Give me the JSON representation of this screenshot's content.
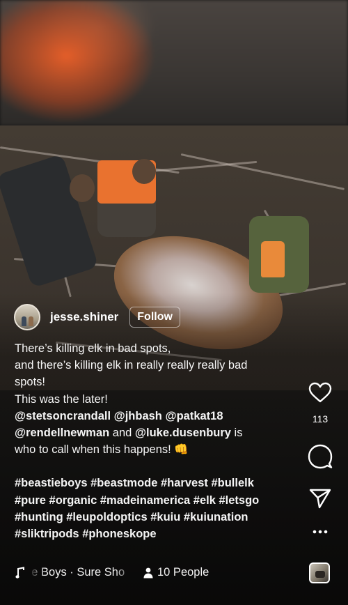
{
  "post": {
    "username": "jesse.shiner",
    "follow_label": "Follow",
    "caption": {
      "line1": "There’s killing elk in bad spots,",
      "line2": "and there’s killing elk in really really really bad",
      "line3": "spots!",
      "line4": "This was the later!",
      "line5": "@stetsoncrandall @jhbash @patkat18",
      "line6_m1": "@rendellnewman",
      "line6_and": " and ",
      "line6_m2": "@luke.dusenbury",
      "line6_is": " is",
      "line7": "who to call when this happens! 👊",
      "tags1": "#beastieboys #beastmode #harvest #bullelk",
      "tags2": "#pure #organic #madeinamerica #elk #letsgo",
      "tags3": "#hunting #leupoldoptics #kuiu #kuiunation",
      "tags4": "#sliktripods #phoneskope"
    }
  },
  "actions": {
    "like_count": "113",
    "icons": [
      "heart-icon",
      "comment-icon",
      "share-icon",
      "more-icon",
      "audio-thumbnail"
    ]
  },
  "footer": {
    "audio_label": "tie Boys · Sure Sho",
    "people_label": "10 People",
    "icons": [
      "music-note-icon",
      "person-icon"
    ]
  },
  "colors": {
    "vest_orange": "#e9722f",
    "text": "#ffffff"
  }
}
